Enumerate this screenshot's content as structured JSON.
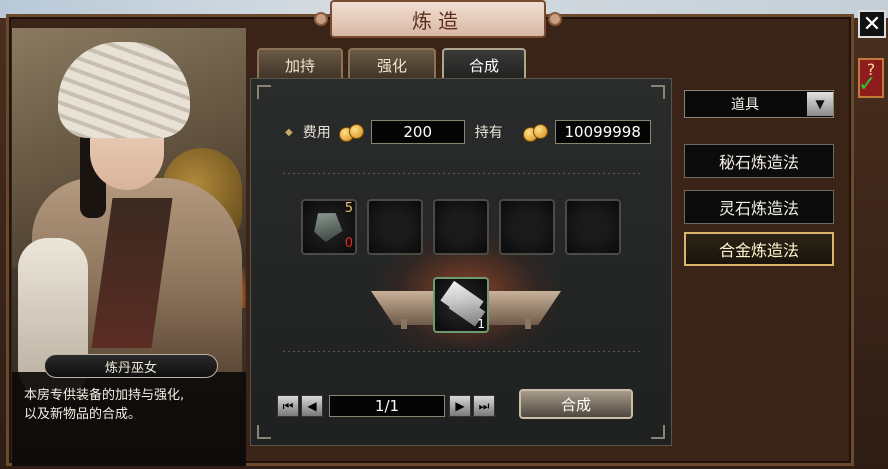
{
  "window": {
    "title": "炼造"
  },
  "tabs": [
    {
      "label": "加持"
    },
    {
      "label": "强化"
    },
    {
      "label": "合成"
    }
  ],
  "npc": {
    "name": "炼丹巫女",
    "description_line1": "本房专供装备的加持与强化,",
    "description_line2": "以及新物品的合成。"
  },
  "cost": {
    "fee_label": "费用",
    "fee_value": "200",
    "held_label": "持有",
    "held_value": "10099998"
  },
  "material_slot": {
    "have": "5",
    "need": "0"
  },
  "result_slot": {
    "qty": "1"
  },
  "pager": {
    "page": "1/1"
  },
  "craft_button": {
    "label": "合成"
  },
  "filter": {
    "selected": "道具"
  },
  "recipes": [
    {
      "label": "秘石炼造法"
    },
    {
      "label": "灵石炼造法"
    },
    {
      "label": "合金炼造法"
    }
  ],
  "colors": {
    "active_recipe_border": "#d9b46a",
    "insufficient": "#e02a1c",
    "fee_gold": "#e6c070"
  }
}
